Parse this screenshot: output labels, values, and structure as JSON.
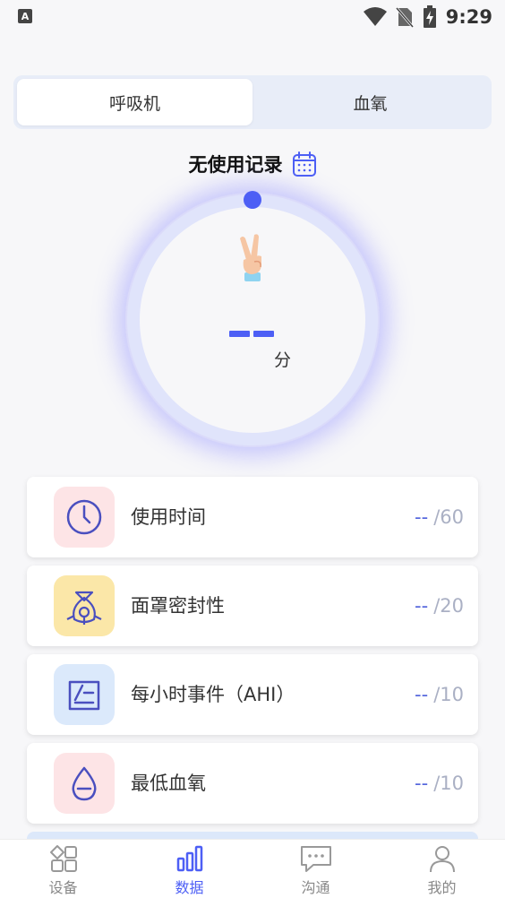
{
  "status_bar": {
    "notification_letter": "A",
    "time": "9:29"
  },
  "tabs": [
    {
      "label": "呼吸机",
      "active": true
    },
    {
      "label": "血氧",
      "active": false
    }
  ],
  "record": {
    "title": "无使用记录",
    "icon": "calendar-icon"
  },
  "usage_ring": {
    "value": "--",
    "unit": "分",
    "emoji": "victory-hand"
  },
  "metrics": [
    {
      "label": "使用时间",
      "score": "--",
      "max": "/60",
      "icon": "clock-icon",
      "icon_bg": "#fde4e6",
      "icon_color": "#4a4fbf"
    },
    {
      "label": "面罩密封性",
      "score": "--",
      "max": "/20",
      "icon": "mask-icon",
      "icon_bg": "#fbe7a8",
      "icon_color": "#4a4fbf"
    },
    {
      "label": "每小时事件（AHI）",
      "score": "--",
      "max": "/10",
      "icon": "chart-icon",
      "icon_bg": "#dbe9fb",
      "icon_color": "#4a4fbf"
    },
    {
      "label": "最低血氧",
      "score": "--",
      "max": "/10",
      "icon": "drop-icon",
      "icon_bg": "#fde4e6",
      "icon_color": "#4a4fbf"
    }
  ],
  "bottom_nav": [
    {
      "label": "设备",
      "icon": "grid-icon",
      "active": false
    },
    {
      "label": "数据",
      "icon": "bar-chart-icon",
      "active": true
    },
    {
      "label": "沟通",
      "icon": "chat-icon",
      "active": false
    },
    {
      "label": "我的",
      "icon": "user-icon",
      "active": false
    }
  ],
  "colors": {
    "accent": "#4d5ff5",
    "ring_track": "#e0e4fb",
    "tab_bg": "#e8edf8",
    "inactive": "#888888"
  }
}
